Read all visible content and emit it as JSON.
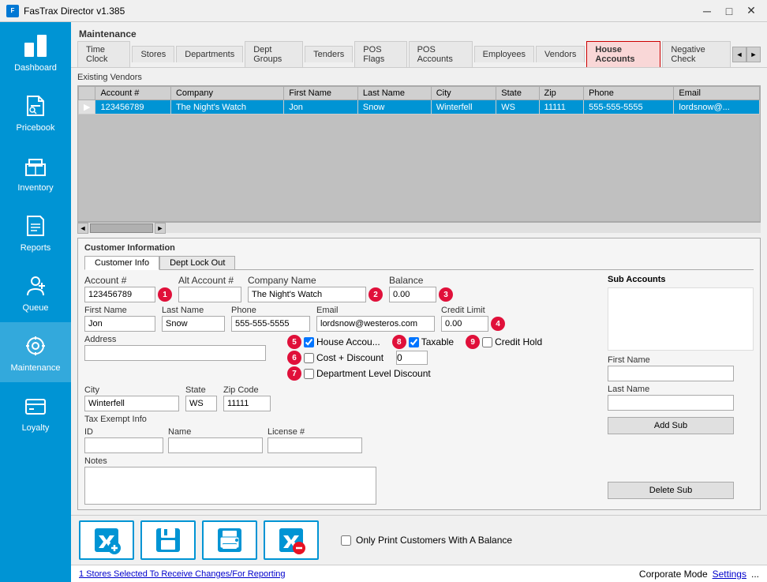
{
  "titleBar": {
    "title": "FasTrax Director v1.385",
    "controls": [
      "minimize",
      "maximize",
      "close"
    ]
  },
  "sidebar": {
    "items": [
      {
        "id": "dashboard",
        "label": "Dashboard",
        "active": false
      },
      {
        "id": "pricebook",
        "label": "Pricebook",
        "active": false
      },
      {
        "id": "inventory",
        "label": "Inventory",
        "active": false
      },
      {
        "id": "reports",
        "label": "Reports",
        "active": false
      },
      {
        "id": "queue",
        "label": "Queue",
        "active": false
      },
      {
        "id": "maintenance",
        "label": "Maintenance",
        "active": true
      },
      {
        "id": "loyalty",
        "label": "Loyalty",
        "active": false
      }
    ]
  },
  "mainTitle": "Maintenance",
  "tabs": [
    {
      "id": "time-clock",
      "label": "Time Clock",
      "active": false
    },
    {
      "id": "stores",
      "label": "Stores",
      "active": false
    },
    {
      "id": "departments",
      "label": "Departments",
      "active": false
    },
    {
      "id": "dept-groups",
      "label": "Dept Groups",
      "active": false
    },
    {
      "id": "tenders",
      "label": "Tenders",
      "active": false
    },
    {
      "id": "pos-flags",
      "label": "POS Flags",
      "active": false
    },
    {
      "id": "pos-accounts",
      "label": "POS Accounts",
      "active": false
    },
    {
      "id": "employees",
      "label": "Employees",
      "active": false
    },
    {
      "id": "vendors",
      "label": "Vendors",
      "active": false
    },
    {
      "id": "house-accounts",
      "label": "House Accounts",
      "active": true
    },
    {
      "id": "negative-check",
      "label": "Negative Check",
      "active": false
    }
  ],
  "vendorsSection": {
    "label": "Existing Vendors",
    "columns": [
      "Account #",
      "Company",
      "First Name",
      "Last Name",
      "City",
      "State",
      "Zip",
      "Phone",
      "Email"
    ],
    "rows": [
      {
        "indicator": "▶",
        "accountNum": "123456789",
        "company": "The Night's Watch",
        "firstName": "Jon",
        "lastName": "Snow",
        "city": "Winterfell",
        "state": "WS",
        "zip": "11111",
        "phone": "555-555-5555",
        "email": "lordsnow@..."
      }
    ]
  },
  "customerInfo": {
    "sectionTitle": "Customer Information",
    "subTabs": [
      {
        "id": "customer-info",
        "label": "Customer Info",
        "active": true
      },
      {
        "id": "dept-lock-out",
        "label": "Dept Lock Out",
        "active": false
      }
    ],
    "fields": {
      "accountNum": {
        "label": "Account #",
        "value": "123456789",
        "badge": "1"
      },
      "altAccountNum": {
        "label": "Alt Account #",
        "value": ""
      },
      "companyName": {
        "label": "Company Name",
        "value": "The Night's Watch",
        "badge": "2"
      },
      "balance": {
        "label": "Balance",
        "value": "0.00",
        "badge": "3"
      },
      "firstName": {
        "label": "First Name",
        "value": "Jon"
      },
      "lastName": {
        "label": "Last Name",
        "value": "Snow"
      },
      "phone": {
        "label": "Phone",
        "value": "555-555-5555"
      },
      "email": {
        "label": "Email",
        "value": "lordsnow@westeros.com"
      },
      "creditLimit": {
        "label": "Credit Limit",
        "value": "0.00",
        "badge": "4"
      },
      "address": {
        "label": "Address",
        "value": ""
      },
      "city": {
        "label": "City",
        "value": "Winterfell"
      },
      "state": {
        "label": "State",
        "value": "WS"
      },
      "zipCode": {
        "label": "Zip Code",
        "value": "11111"
      },
      "notes": {
        "label": "Notes",
        "value": ""
      }
    },
    "checkboxes": {
      "houseAccount": {
        "label": "House Accou...",
        "checked": true,
        "badge": "5"
      },
      "taxable": {
        "label": "Taxable",
        "checked": true,
        "badge": "8"
      },
      "creditHold": {
        "label": "Credit Hold",
        "checked": false,
        "badge": "9"
      },
      "costDiscount": {
        "label": "Cost + Discount",
        "checked": false,
        "badge": "6"
      },
      "costDiscountValue": "0",
      "deptLevelDiscount": {
        "label": "Department Level Discount",
        "checked": false,
        "badge": "7"
      }
    },
    "taxExempt": {
      "label": "Tax Exempt Info",
      "id": {
        "label": "ID",
        "value": ""
      },
      "name": {
        "label": "Name",
        "value": ""
      },
      "licenseNum": {
        "label": "License #",
        "value": ""
      }
    },
    "subAccounts": {
      "label": "Sub Accounts",
      "firstName": {
        "label": "First Name",
        "value": ""
      },
      "lastName": {
        "label": "Last Name",
        "value": ""
      },
      "addSubLabel": "Add Sub",
      "deleteSubLabel": "Delete Sub"
    }
  },
  "bottomBar": {
    "buttons": [
      {
        "id": "add",
        "icon": "add-icon"
      },
      {
        "id": "save",
        "icon": "save-icon"
      },
      {
        "id": "print",
        "icon": "print-icon"
      },
      {
        "id": "delete",
        "icon": "delete-icon"
      }
    ],
    "printCheck": {
      "label": "Only Print Customers With A Balance",
      "checked": false
    }
  },
  "statusBar": {
    "storesLink": "1 Stores Selected To Receive Changes/For Reporting",
    "mode": "Corporate Mode",
    "settingsLink": "Settings"
  }
}
